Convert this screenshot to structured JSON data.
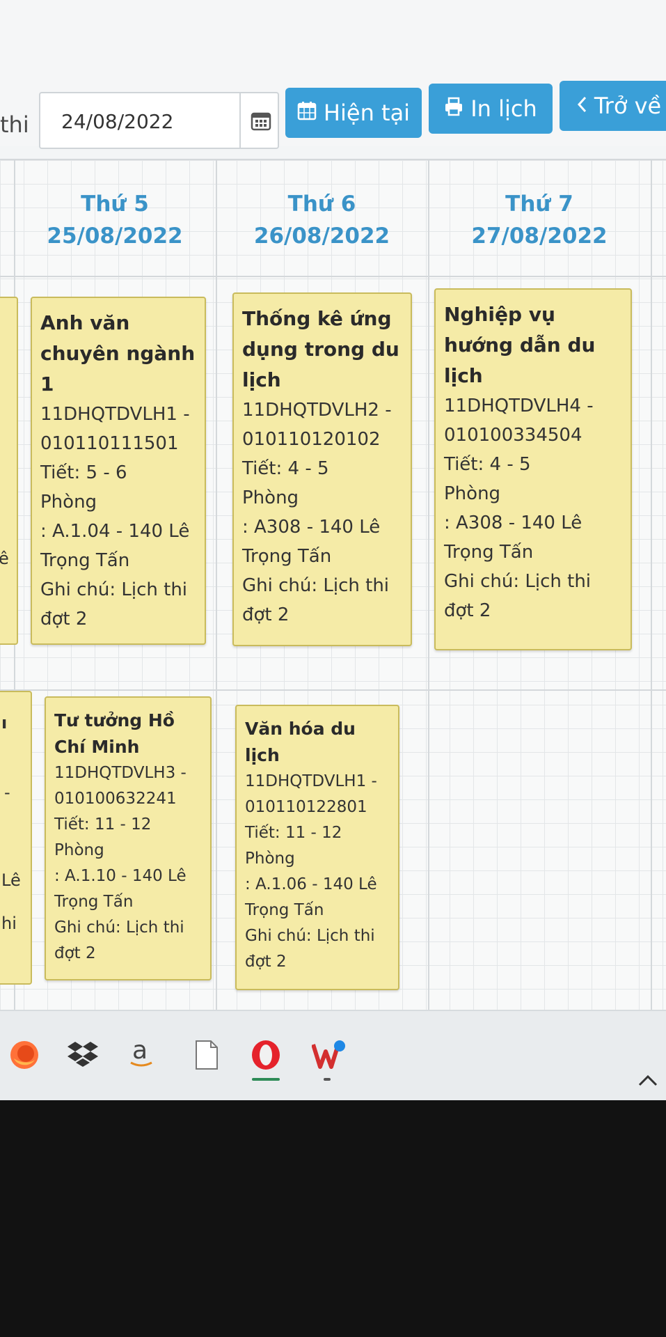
{
  "toolbar": {
    "date_label": "thi",
    "date_value": "24/08/2022",
    "btn_now": "Hiện tại",
    "btn_print": "In lịch",
    "btn_back": "Trở về"
  },
  "days": [
    {
      "name": "Thứ 5",
      "date": "25/08/2022"
    },
    {
      "name": "Thứ 6",
      "date": "26/08/2022"
    },
    {
      "name": "Thứ 7",
      "date": "27/08/2022"
    }
  ],
  "events_morning": [
    {
      "title_lines": [
        "Anh văn",
        "chuyên ngành",
        "1"
      ],
      "code1": "11DHQTDVLH1 -",
      "code2": "010110111501",
      "period": "Tiết: 5 - 6",
      "room1": "Phòng",
      "room2": ": A.1.04 - 140 Lê",
      "room3": "Trọng Tấn",
      "note1": "Ghi chú: Lịch thi",
      "note2": "đợt 2"
    },
    {
      "title_lines": [
        "Thống kê ứng",
        "dụng trong du",
        "lịch"
      ],
      "code1": "11DHQTDVLH2 -",
      "code2": "010110120102",
      "period": "Tiết: 4 - 5",
      "room1": "Phòng",
      "room2": ": A308 - 140 Lê",
      "room3": "Trọng Tấn",
      "note1": "Ghi chú: Lịch thi",
      "note2": "đợt 2"
    },
    {
      "title_lines": [
        "Nghiệp vụ",
        "hướng dẫn du",
        "lịch"
      ],
      "code1": "11DHQTDVLH4 -",
      "code2": "010100334504",
      "period": "Tiết: 4 - 5",
      "room1": "Phòng",
      "room2": ": A308 - 140 Lê",
      "room3": "Trọng Tấn",
      "note1": "Ghi chú: Lịch thi",
      "note2": "đợt 2"
    }
  ],
  "events_afternoon": [
    {
      "title_lines": [
        "Tư tưởng Hồ",
        "Chí Minh"
      ],
      "code1": "11DHQTDVLH3 -",
      "code2": "010100632241",
      "period": "Tiết: 11 - 12",
      "room1": "Phòng",
      "room2": ": A.1.10 - 140 Lê",
      "room3": "Trọng Tấn",
      "note1": "Ghi chú: Lịch thi",
      "note2": "đợt 2"
    },
    {
      "title_lines": [
        "Văn hóa du",
        "lịch"
      ],
      "code1": "11DHQTDVLH1 -",
      "code2": "010110122801",
      "period": "Tiết: 11 - 12",
      "room1": "Phòng",
      "room2": ": A.1.06 - 140 Lê",
      "room3": "Trọng Tấn",
      "note1": "Ghi chú: Lịch thi",
      "note2": "đợt 2"
    }
  ],
  "partial_left": {
    "morning_fragment": "ê",
    "afternoon_fragments": [
      "ı",
      "-",
      "Lê",
      "hi"
    ]
  },
  "taskbar": {
    "icons": [
      "firefox-icon",
      "dropbox-icon",
      "amazon-icon",
      "file-icon",
      "opera-icon",
      "wps-office-icon",
      "chevron-up-icon"
    ],
    "amazon_letter": "a"
  },
  "colors": {
    "accent": "#3a9fd8",
    "event_bg": "#f5eba7",
    "day_header": "#3a93c8"
  }
}
